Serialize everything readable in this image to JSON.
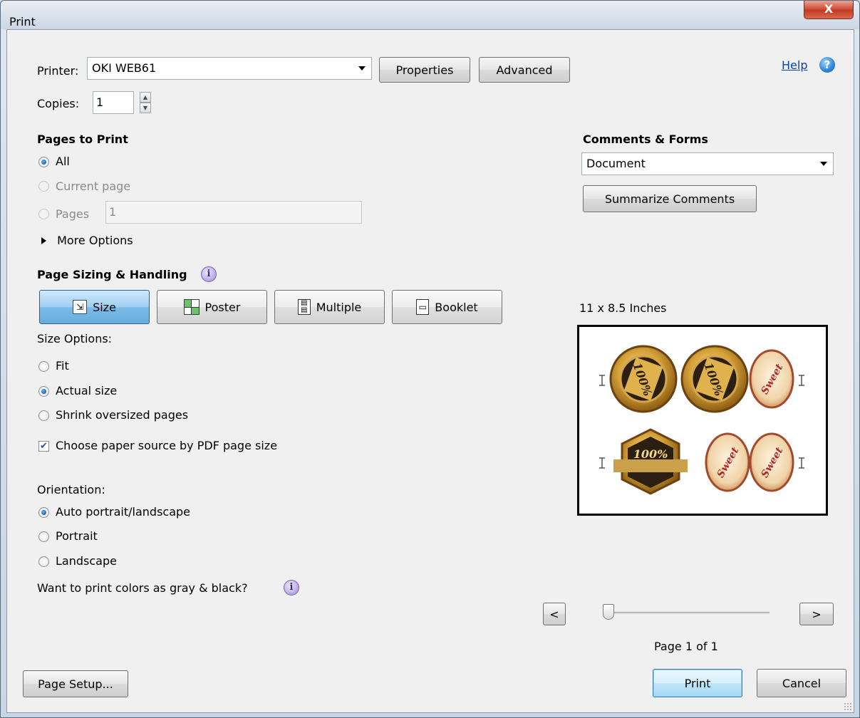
{
  "window": {
    "title": "Print",
    "close_label": "X"
  },
  "printer": {
    "label": "Printer:",
    "selected": "OKI WEB61",
    "properties_label": "Properties",
    "advanced_label": "Advanced"
  },
  "help": {
    "label": "Help"
  },
  "copies": {
    "label": "Copies:",
    "value": "1"
  },
  "pages_to_print": {
    "heading": "Pages to Print",
    "all_label": "All",
    "current_page_label": "Current page",
    "pages_label": "Pages",
    "pages_value": "1",
    "more_options_label": "More Options"
  },
  "comments_forms": {
    "heading": "Comments & Forms",
    "selected": "Document",
    "summarize_label": "Summarize Comments"
  },
  "page_sizing": {
    "heading": "Page Sizing & Handling",
    "tabs": [
      {
        "label": "Size",
        "active": true
      },
      {
        "label": "Poster",
        "active": false
      },
      {
        "label": "Multiple",
        "active": false
      },
      {
        "label": "Booklet",
        "active": false
      }
    ],
    "size_options_label": "Size Options:",
    "fit_label": "Fit",
    "actual_size_label": "Actual size",
    "shrink_label": "Shrink oversized pages",
    "paper_source_label": "Choose paper source by PDF page size"
  },
  "orientation": {
    "label": "Orientation:",
    "auto_label": "Auto portrait/landscape",
    "portrait_label": "Portrait",
    "landscape_label": "Landscape"
  },
  "gray_label": "Want to print colors as gray & black?",
  "preview": {
    "size_label": "11 x 8.5 Inches",
    "page_label": "Page 1 of 1",
    "prev_label": "<",
    "next_label": ">",
    "slider_value": 0,
    "badge_text_1": "100%",
    "badge_text_2": "Sweet"
  },
  "buttons": {
    "page_setup": "Page Setup...",
    "print": "Print",
    "cancel": "Cancel"
  },
  "colors": {
    "accent": "#68addf",
    "link": "#0645ad"
  }
}
